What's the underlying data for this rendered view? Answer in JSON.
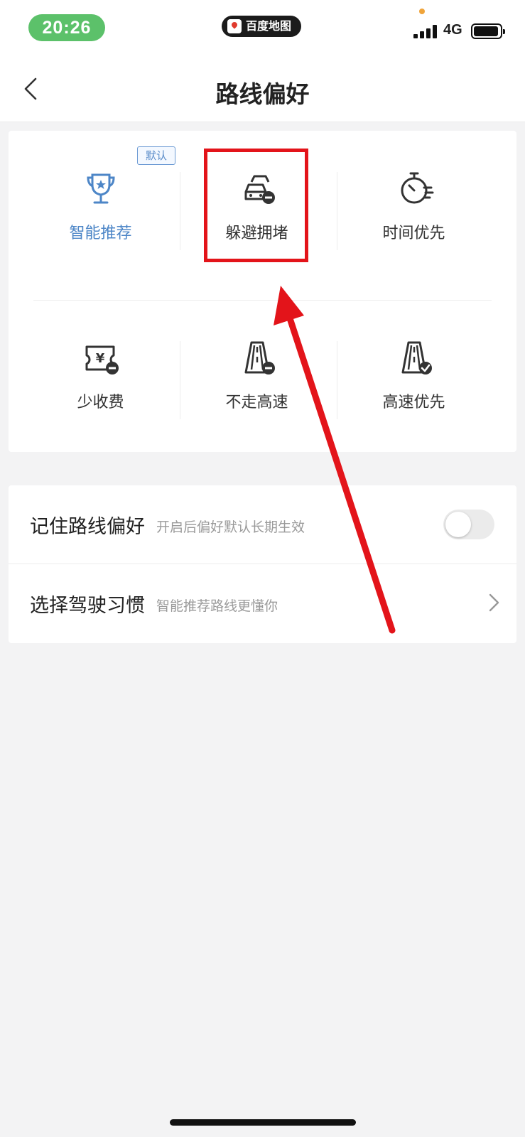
{
  "status_bar": {
    "time": "20:26",
    "app_name": "百度地图",
    "network": "4G",
    "time_pill_color": "#5cc16a"
  },
  "nav": {
    "back_icon": "chevron-left-icon",
    "title": "路线偏好"
  },
  "preferences": {
    "default_badge": "默认",
    "highlighted_item": "躲避拥堵",
    "highlight_color": "#e3141a",
    "items": [
      {
        "label": "智能推荐",
        "icon": "trophy-icon",
        "selected": true
      },
      {
        "label": "躲避拥堵",
        "icon": "car-congestion-icon",
        "selected": false
      },
      {
        "label": "时间优先",
        "icon": "stopwatch-icon",
        "selected": false
      },
      {
        "label": "少收费",
        "icon": "toll-ticket-icon",
        "selected": false
      },
      {
        "label": "不走高速",
        "icon": "highway-avoid-icon",
        "selected": false
      },
      {
        "label": "高速优先",
        "icon": "highway-prefer-icon",
        "selected": false
      }
    ]
  },
  "settings": {
    "remember": {
      "title": "记住路线偏好",
      "subtitle": "开启后偏好默认长期生效",
      "toggle_on": false
    },
    "habit": {
      "title": "选择驾驶习惯",
      "subtitle": "智能推荐路线更懂你",
      "icon": "chevron-right-icon"
    }
  },
  "accent_color": "#4d86c7"
}
